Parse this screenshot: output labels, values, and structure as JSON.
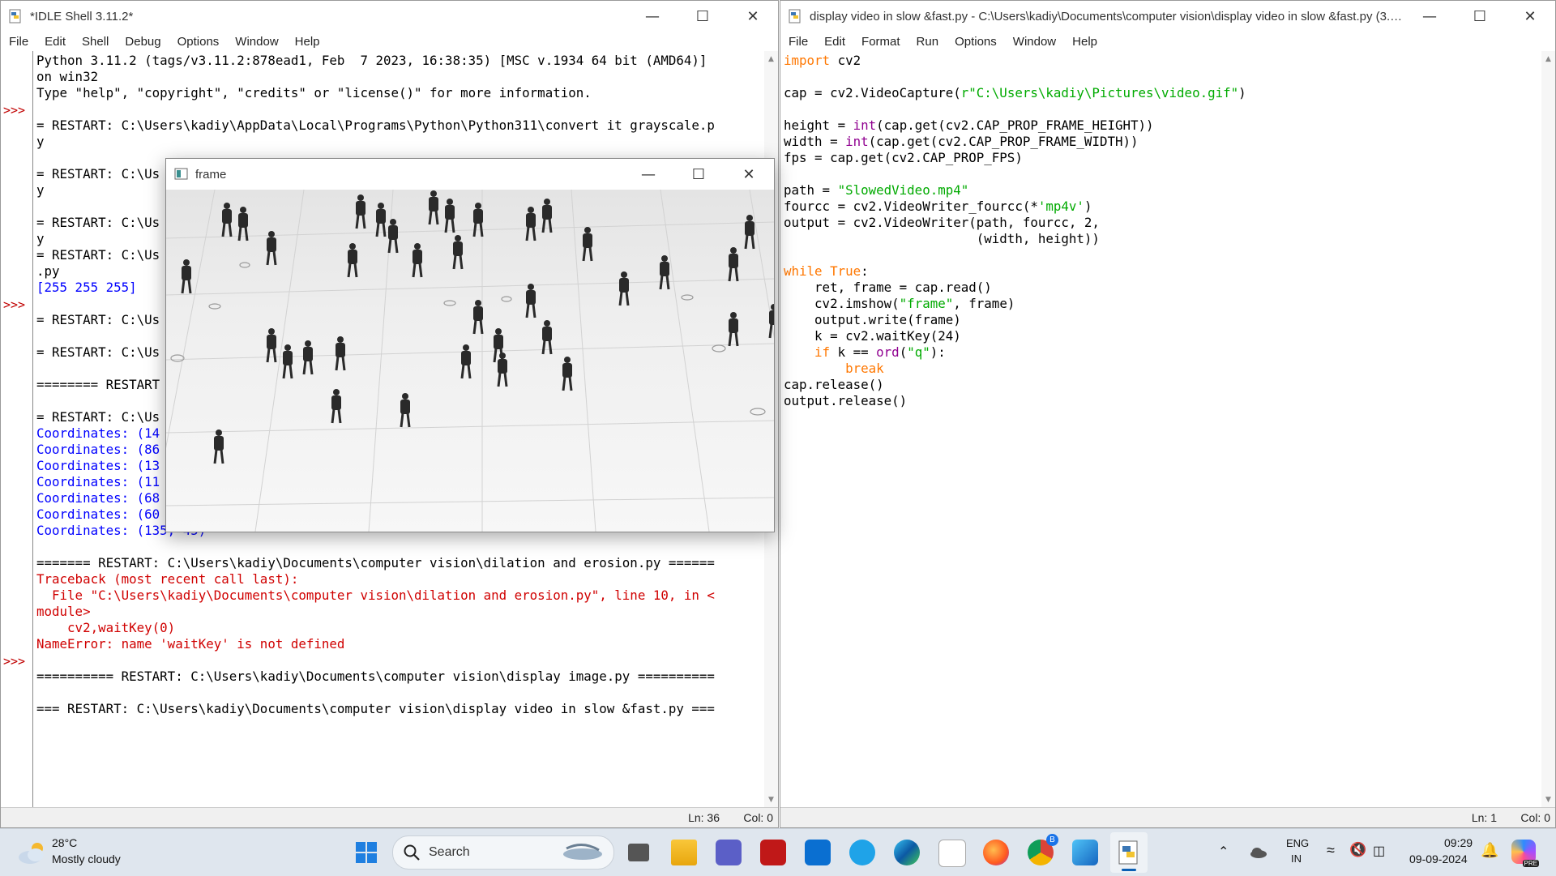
{
  "shell": {
    "title": "*IDLE Shell 3.11.2*",
    "menu": [
      "File",
      "Edit",
      "Shell",
      "Debug",
      "Options",
      "Window",
      "Help"
    ],
    "lines": [
      {
        "t": "Python 3.11.2 (tags/v3.11.2:878ead1, Feb  7 2023, 16:38:35) [MSC v.1934 64 bit (AMD64)]",
        "c": ""
      },
      {
        "t": "on win32",
        "c": ""
      },
      {
        "t": "Type \"help\", \"copyright\", \"credits\" or \"license()\" for more information.",
        "c": ""
      },
      {
        "t": "",
        "c": ""
      },
      {
        "t": "= RESTART: C:\\Users\\kadiy\\AppData\\Local\\Programs\\Python\\Python311\\convert it grayscale.p",
        "c": ""
      },
      {
        "t": "y",
        "c": ""
      },
      {
        "t": "",
        "c": ""
      },
      {
        "t": "= RESTART: C:\\Us",
        "c": ""
      },
      {
        "t": "y",
        "c": ""
      },
      {
        "t": "",
        "c": ""
      },
      {
        "t": "= RESTART: C:\\Us",
        "c": ""
      },
      {
        "t": "y",
        "c": ""
      },
      {
        "t": "= RESTART: C:\\Us",
        "c": ""
      },
      {
        "t": ".py",
        "c": ""
      },
      {
        "t": "[255 255 255]",
        "c": "blue"
      },
      {
        "t": "",
        "c": ""
      },
      {
        "t": "= RESTART: C:\\Us",
        "c": ""
      },
      {
        "t": "",
        "c": ""
      },
      {
        "t": "= RESTART: C:\\Us",
        "c": ""
      },
      {
        "t": "",
        "c": ""
      },
      {
        "t": "======== RESTART",
        "c": ""
      },
      {
        "t": "",
        "c": ""
      },
      {
        "t": "= RESTART: C:\\Us",
        "c": ""
      },
      {
        "t": "Coordinates: (14",
        "c": "blue"
      },
      {
        "t": "Coordinates: (86",
        "c": "blue"
      },
      {
        "t": "Coordinates: (13",
        "c": "blue"
      },
      {
        "t": "Coordinates: (11",
        "c": "blue"
      },
      {
        "t": "Coordinates: (68",
        "c": "blue"
      },
      {
        "t": "Coordinates: (60",
        "c": "blue"
      },
      {
        "t": "Coordinates: (135, 45)",
        "c": "blue"
      },
      {
        "t": "",
        "c": ""
      },
      {
        "t": "======= RESTART: C:\\Users\\kadiy\\Documents\\computer vision\\dilation and erosion.py ======",
        "c": ""
      },
      {
        "t": "Traceback (most recent call last):",
        "c": "red"
      },
      {
        "t": "  File \"C:\\Users\\kadiy\\Documents\\computer vision\\dilation and erosion.py\", line 10, in <",
        "c": "red"
      },
      {
        "t": "module>",
        "c": "red"
      },
      {
        "t": "    cv2,waitKey(0)",
        "c": "red"
      },
      {
        "t": "NameError: name 'waitKey' is not defined",
        "c": "red"
      },
      {
        "t": "",
        "c": ""
      },
      {
        "t": "========== RESTART: C:\\Users\\kadiy\\Documents\\computer vision\\display image.py ==========",
        "c": ""
      },
      {
        "t": "",
        "c": ""
      },
      {
        "t": "=== RESTART: C:\\Users\\kadiy\\Documents\\computer vision\\display video in slow &fast.py ===",
        "c": ""
      }
    ],
    "prompts": [
      ">>>",
      ">>>",
      ">>>"
    ],
    "status_ln": "Ln: 36",
    "status_col": "Col: 0"
  },
  "editor": {
    "title": "display video in slow &fast.py - C:\\Users\\kadiy\\Documents\\computer vision\\display video in slow &fast.py (3.1...",
    "menu": [
      "File",
      "Edit",
      "Format",
      "Run",
      "Options",
      "Window",
      "Help"
    ],
    "code": [
      [
        {
          "t": "import",
          "c": "orange"
        },
        {
          "t": " cv2",
          "c": ""
        }
      ],
      [],
      [
        {
          "t": "cap = cv2.VideoCapture(",
          "c": ""
        },
        {
          "t": "r\"C:\\Users\\kadiy\\Pictures\\video.gif\"",
          "c": "green"
        },
        {
          "t": ")",
          "c": ""
        }
      ],
      [],
      [
        {
          "t": "height = ",
          "c": ""
        },
        {
          "t": "int",
          "c": "purple"
        },
        {
          "t": "(cap.get(cv2.CAP_PROP_FRAME_HEIGHT))",
          "c": ""
        }
      ],
      [
        {
          "t": "width = ",
          "c": ""
        },
        {
          "t": "int",
          "c": "purple"
        },
        {
          "t": "(cap.get(cv2.CAP_PROP_FRAME_WIDTH))",
          "c": ""
        }
      ],
      [
        {
          "t": "fps = cap.get(cv2.CAP_PROP_FPS)",
          "c": ""
        }
      ],
      [],
      [
        {
          "t": "path = ",
          "c": ""
        },
        {
          "t": "\"SlowedVideo.mp4\"",
          "c": "green"
        }
      ],
      [
        {
          "t": "fourcc = cv2.VideoWriter_fourcc(*",
          "c": ""
        },
        {
          "t": "'mp4v'",
          "c": "green"
        },
        {
          "t": ")",
          "c": ""
        }
      ],
      [
        {
          "t": "output = cv2.VideoWriter(path, fourcc, 2,",
          "c": ""
        }
      ],
      [
        {
          "t": "                         (width, height))",
          "c": ""
        }
      ],
      [],
      [
        {
          "t": "while",
          "c": "orange"
        },
        {
          "t": " ",
          "c": ""
        },
        {
          "t": "True",
          "c": "orange"
        },
        {
          "t": ":",
          "c": ""
        }
      ],
      [
        {
          "t": "    ret, frame = cap.read()",
          "c": ""
        }
      ],
      [
        {
          "t": "    cv2.imshow(",
          "c": ""
        },
        {
          "t": "\"frame\"",
          "c": "green"
        },
        {
          "t": ", frame)",
          "c": ""
        }
      ],
      [
        {
          "t": "    output.write(frame)",
          "c": ""
        }
      ],
      [
        {
          "t": "    k = cv2.waitKey(24)",
          "c": ""
        }
      ],
      [
        {
          "t": "    ",
          "c": ""
        },
        {
          "t": "if",
          "c": "orange"
        },
        {
          "t": " k == ",
          "c": ""
        },
        {
          "t": "ord",
          "c": "purple"
        },
        {
          "t": "(",
          "c": ""
        },
        {
          "t": "\"q\"",
          "c": "green"
        },
        {
          "t": "):",
          "c": ""
        }
      ],
      [
        {
          "t": "        ",
          "c": ""
        },
        {
          "t": "break",
          "c": "orange"
        }
      ],
      [
        {
          "t": "cap.release()",
          "c": ""
        }
      ],
      [
        {
          "t": "output.release()",
          "c": ""
        }
      ]
    ],
    "status_ln": "Ln: 1",
    "status_col": "Col: 0"
  },
  "frame_window": {
    "title": "frame"
  },
  "taskbar": {
    "weather_temp": "28°C",
    "weather_desc": "Mostly cloudy",
    "search_label": "Search",
    "lang_top": "ENG",
    "lang_bottom": "IN",
    "time": "09:29",
    "date": "09-09-2024",
    "chrome_badge": "B",
    "copilot_badge": "PRE"
  },
  "colors": {
    "prompt": "#c00000",
    "keyword": "#ff7700",
    "string": "#00aa00",
    "builtin": "#900090",
    "output": "#0000ff",
    "error": "#d00000"
  }
}
